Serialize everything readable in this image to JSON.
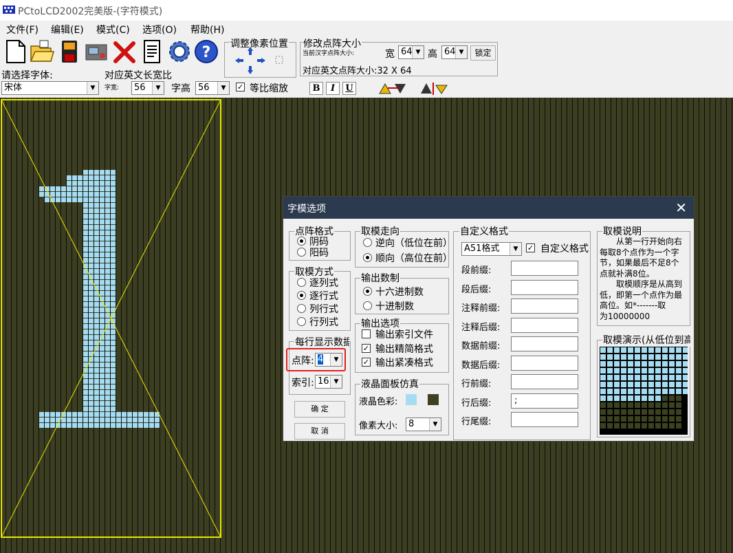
{
  "window": {
    "title": "PCtoLCD2002完美版-(字符模式)"
  },
  "menu": [
    "文件(F)",
    "编辑(E)",
    "模式(C)",
    "选项(O)",
    "帮助(H)"
  ],
  "toolbar": {
    "adjust_group_title": "调整像素位置",
    "resize_group_title": "修改点阵大小",
    "resize_small_label": "当前汉字点阵大小:",
    "width_label": "宽",
    "width_value": "64",
    "height_label": "高",
    "height_value": "64",
    "lock_label": "锁定",
    "english_size_label": "对应英文点阵大小:32 X 64",
    "font_label": "请选择字体:",
    "ratio_label": "对应英文长宽比",
    "font_value": "宋体",
    "char_width_label": "字宽:",
    "char_width_value": "56",
    "char_height_label": "字高",
    "char_height_value": "56",
    "scale_checkbox_label": "等比缩放",
    "scale_checked": true,
    "bold_label": "B",
    "italic_label": "I",
    "underline_label": "U"
  },
  "canvas": {
    "grid_color": "#3c3e21",
    "pixel_color": "#a6dcf2",
    "frame_color": "#e8e800",
    "character": "1"
  },
  "dialog": {
    "title": "字模选项",
    "dot_format": {
      "title": "点阵格式",
      "options": [
        "阴码",
        "阳码"
      ],
      "selected": 0
    },
    "mode": {
      "title": "取模方式",
      "options": [
        "逐列式",
        "逐行式",
        "列行式",
        "行列式"
      ],
      "selected": 1
    },
    "per_line": {
      "title": "每行显示数据",
      "dot_label": "点阵:",
      "dot_value": "4",
      "index_label": "索引:",
      "index_value": "16"
    },
    "ok_label": "确 定",
    "cancel_label": "取 消",
    "direction": {
      "title": "取模走向",
      "options": [
        "逆向（低位在前）",
        "顺向（高位在前）"
      ],
      "selected": 1
    },
    "number_format": {
      "title": "输出数制",
      "options": [
        "十六进制数",
        "十进制数"
      ],
      "selected": 0
    },
    "output_options": {
      "title": "输出选项",
      "items": [
        {
          "label": "输出索引文件",
          "checked": false
        },
        {
          "label": "输出精简格式",
          "checked": true
        },
        {
          "label": "输出紧凑格式",
          "checked": true
        }
      ]
    },
    "lcd": {
      "title": "液晶面板仿真",
      "color_label": "液晶色彩:",
      "color_on": "#a6dcf2",
      "color_off": "#3c4220",
      "pixel_size_label": "像素大小:",
      "pixel_size_value": "8"
    },
    "custom": {
      "title": "自定义格式",
      "format_value": "A51格式",
      "custom_checkbox_label": "自定义格式",
      "custom_checked": true,
      "fields": [
        {
          "label": "段前缀:",
          "value": ""
        },
        {
          "label": "段后缀:",
          "value": ""
        },
        {
          "label": "注释前缀:",
          "value": ""
        },
        {
          "label": "注释后缀:",
          "value": ""
        },
        {
          "label": "数据前缀:",
          "value": ""
        },
        {
          "label": "数据后缀:",
          "value": ""
        },
        {
          "label": "行前缀:",
          "value": ""
        },
        {
          "label": "行后缀:",
          "value": ";"
        },
        {
          "label": "行尾缀:",
          "value": ""
        }
      ]
    },
    "explain": {
      "title": "取模说明",
      "lines": [
        "　　从第一行开始向右",
        "每取8个点作为一个字",
        "节，如果最后不足8个",
        "点就补满8位。",
        "　　取模顺序是从高到",
        "低，即第一个点作为最",
        "高位。如*-------取",
        "为10000000"
      ]
    },
    "demo": {
      "title": "取模演示(从低位到高位)"
    }
  }
}
